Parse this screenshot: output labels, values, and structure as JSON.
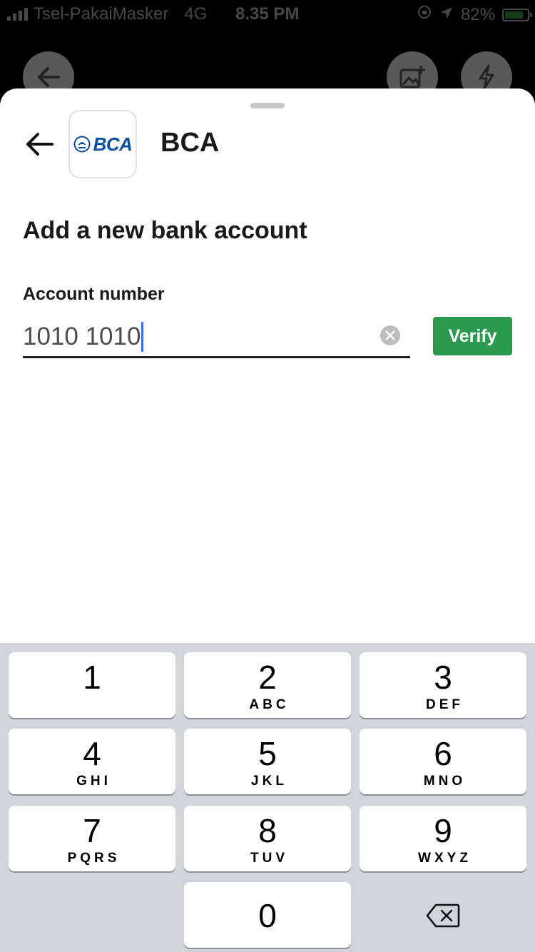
{
  "status_bar": {
    "carrier": "Tsel-PakaiMasker",
    "network": "4G",
    "time": "8.35 PM",
    "battery": "82%",
    "battery_level": 0.82
  },
  "background": {
    "icons": [
      "back-arrow-icon",
      "add-photo-icon",
      "flash-icon"
    ]
  },
  "header": {
    "bank_logo_text": "BCA",
    "bank_name": "BCA"
  },
  "page": {
    "title": "Add a new bank account"
  },
  "form": {
    "account_label": "Account number",
    "account_value": "1010 1010",
    "verify_label": "Verify"
  },
  "keypad": {
    "keys": [
      {
        "digit": "1",
        "letters": ""
      },
      {
        "digit": "2",
        "letters": "ABC"
      },
      {
        "digit": "3",
        "letters": "DEF"
      },
      {
        "digit": "4",
        "letters": "GHI"
      },
      {
        "digit": "5",
        "letters": "JKL"
      },
      {
        "digit": "6",
        "letters": "MNO"
      },
      {
        "digit": "7",
        "letters": "PQRS"
      },
      {
        "digit": "8",
        "letters": "TUV"
      },
      {
        "digit": "9",
        "letters": "WXYZ"
      },
      {
        "digit": "0",
        "letters": ""
      }
    ]
  },
  "colors": {
    "verify": "#2c9a4e",
    "caret": "#3b6cf0",
    "keypad_bg": "#d1d4da",
    "bank_brand": "#0b4ea2"
  }
}
